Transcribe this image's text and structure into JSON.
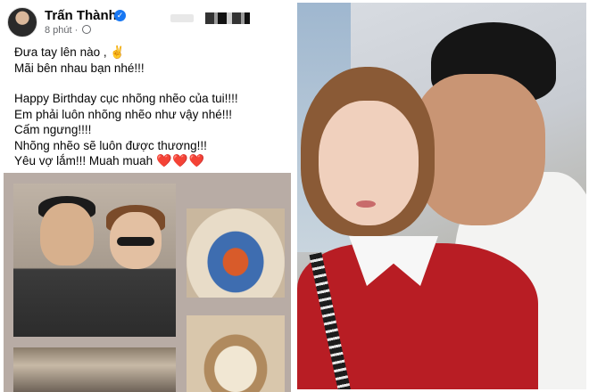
{
  "post": {
    "author": "Trấn Thành",
    "verified_icon": "verified-badge-icon",
    "time": "8 phút",
    "separator": "·",
    "audience_icon": "globe-icon",
    "lines": [
      "Đưa tay lên nào , ✌️",
      "Mãi bên nhau bạn nhé!!!",
      "",
      "Happy Birthday cục nhõng nhẽo của tui!!!!",
      "Em phải luôn nhõng nhẽo như vậy nhé!!!",
      "Cấm ngưng!!!!",
      "Nhõng nhẽo sẽ luôn được thương!!!",
      "Yêu vợ lắm!!! Muah muah"
    ],
    "hearts": "❤️❤️❤️"
  },
  "colors": {
    "facebook_blue": "#1877f2",
    "heart_red": "#e0245e",
    "grid_bg": "#b8aca5"
  }
}
